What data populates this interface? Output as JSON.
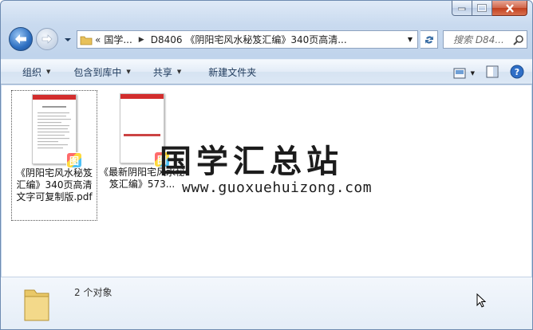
{
  "window": {
    "caption_buttons": [
      "minimize",
      "maximize",
      "close"
    ]
  },
  "address_bar": {
    "overflow": "«",
    "crumbs": [
      "国学...",
      "D8406 《阴阳宅风水秘笈汇编》340页高清..."
    ]
  },
  "search": {
    "placeholder": "搜索 D84..."
  },
  "toolbar": {
    "organize": "组织",
    "include_in_library": "包含到库中",
    "share": "共享",
    "new_folder": "新建文件夹"
  },
  "files": [
    {
      "name": "《阴阳宅风水秘笈汇编》340页高清文字可复制版.pdf",
      "selected": true,
      "badge": "图"
    },
    {
      "name": "《最新阴阳宅风水秘笈汇编》573...",
      "selected": false,
      "badge": "图"
    }
  ],
  "watermark": {
    "title": "国学汇总站",
    "url": "www.guoxuehuizong.com"
  },
  "details": {
    "count_text": "2 个对象"
  },
  "colors": {
    "accent": "#2d6fc1",
    "pdf_red": "#d22d2d",
    "close_red": "#c2401f"
  }
}
